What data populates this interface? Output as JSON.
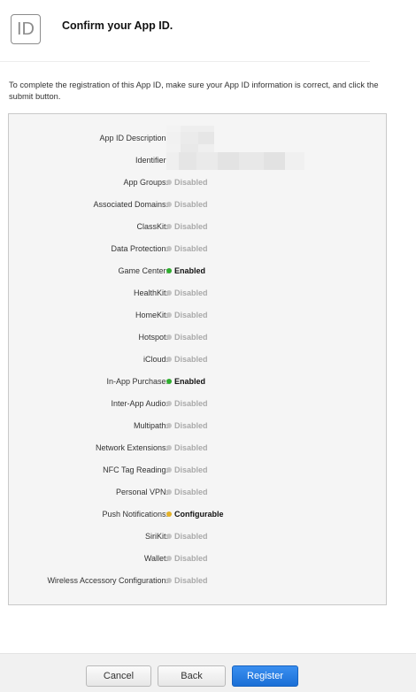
{
  "header": {
    "icon_text": "ID",
    "title": "Confirm your App ID."
  },
  "intro": "To complete the registration of this App ID, make sure your App ID information is correct, and click the submit button.",
  "fields": [
    {
      "label": "App ID Description:",
      "value": ""
    },
    {
      "label": "Identifier:",
      "value": ""
    }
  ],
  "capabilities": [
    {
      "label": "App Groups:",
      "status": "Disabled",
      "state": "disabled"
    },
    {
      "label": "Associated Domains:",
      "status": "Disabled",
      "state": "disabled"
    },
    {
      "label": "ClassKit:",
      "status": "Disabled",
      "state": "disabled"
    },
    {
      "label": "Data Protection:",
      "status": "Disabled",
      "state": "disabled"
    },
    {
      "label": "Game Center:",
      "status": "Enabled",
      "state": "enabled"
    },
    {
      "label": "HealthKit:",
      "status": "Disabled",
      "state": "disabled"
    },
    {
      "label": "HomeKit:",
      "status": "Disabled",
      "state": "disabled"
    },
    {
      "label": "Hotspot:",
      "status": "Disabled",
      "state": "disabled"
    },
    {
      "label": "iCloud:",
      "status": "Disabled",
      "state": "disabled"
    },
    {
      "label": "In-App Purchase:",
      "status": "Enabled",
      "state": "enabled"
    },
    {
      "label": "Inter-App Audio:",
      "status": "Disabled",
      "state": "disabled"
    },
    {
      "label": "Multipath:",
      "status": "Disabled",
      "state": "disabled"
    },
    {
      "label": "Network Extensions:",
      "status": "Disabled",
      "state": "disabled"
    },
    {
      "label": "NFC Tag Reading:",
      "status": "Disabled",
      "state": "disabled"
    },
    {
      "label": "Personal VPN:",
      "status": "Disabled",
      "state": "disabled"
    },
    {
      "label": "Push Notifications:",
      "status": "Configurable",
      "state": "config"
    },
    {
      "label": "SiriKit:",
      "status": "Disabled",
      "state": "disabled"
    },
    {
      "label": "Wallet:",
      "status": "Disabled",
      "state": "disabled"
    },
    {
      "label": "Wireless Accessory Configuration:",
      "status": "Disabled",
      "state": "disabled"
    }
  ],
  "buttons": {
    "cancel": "Cancel",
    "back": "Back",
    "register": "Register"
  },
  "colors": {
    "enabled": "#2fae2f",
    "disabled": "#c4c4c4",
    "configurable": "#e4b22a",
    "primary": "#1a6fd6"
  }
}
